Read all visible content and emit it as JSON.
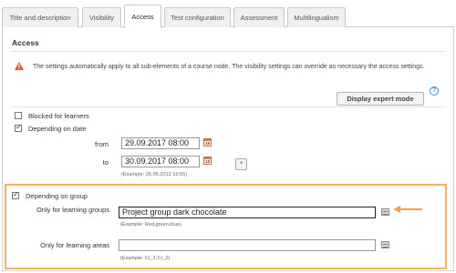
{
  "tabs": [
    {
      "label": "Title and description",
      "active": false
    },
    {
      "label": "Visibility",
      "active": false
    },
    {
      "label": "Access",
      "active": true
    },
    {
      "label": "Test configuration",
      "active": false
    },
    {
      "label": "Assessment",
      "active": false
    },
    {
      "label": "Multilingualism",
      "active": false
    }
  ],
  "section": {
    "title": "Access",
    "warning": "The settings automatically apply to all sub-elements of a course node. The visibility settings can override as necessary the access settings.",
    "expert_button": "Display expert mode",
    "help_icon": "?"
  },
  "blocked": {
    "label": "Blocked for learners",
    "checked": false
  },
  "depending_on_date": {
    "label": "Depending on date",
    "checked": true,
    "from_label": "from",
    "from_value": "29.09.2017 08:00",
    "to_label": "to",
    "to_value": "30.09.2017 08:00",
    "example": "(Example: 26.06.2012 16:55)",
    "add_button": "+",
    "calendar_glyph": "18"
  },
  "depending_on_group": {
    "label": "Depending on group",
    "checked": true,
    "groups_label": "Only for learning groups",
    "groups_value": "Project group dark chocolate",
    "groups_example": "(Example: Red,green,blue)",
    "areas_label": "Only for learning areas",
    "areas_value": "",
    "areas_example": "(Example: Cr_1,Cr_2)"
  },
  "colors": {
    "highlight": "#f0b461",
    "arrow": "#f0a050",
    "warning": "#e05a2b",
    "help": "#3a8fd9"
  }
}
